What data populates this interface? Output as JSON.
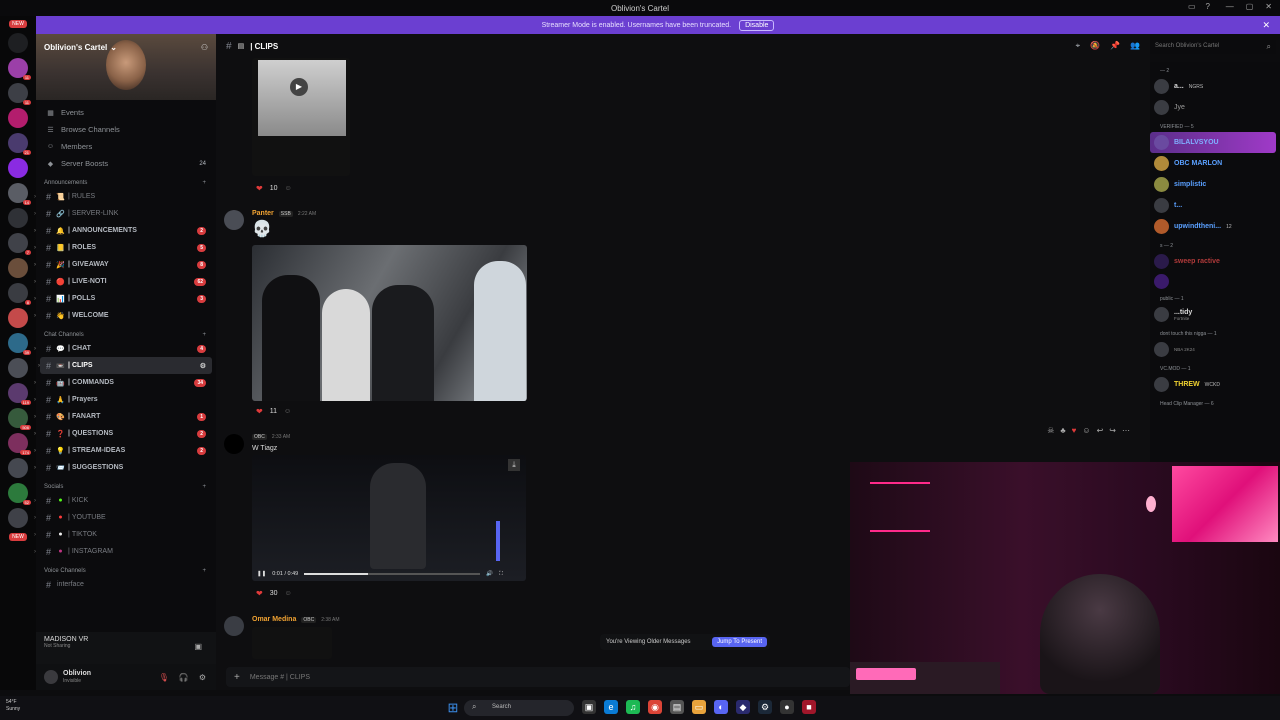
{
  "window": {
    "title": "Oblivion's Cartel"
  },
  "banner": {
    "text": "Streamer Mode is enabled. Usernames have been truncated.",
    "button": "Disable"
  },
  "rail": {
    "new_top": "NEW",
    "new_bottom": "NEW",
    "badges": [
      "11",
      "11",
      "21",
      "14",
      "7",
      "8",
      "39",
      "119",
      "506",
      "174",
      "52"
    ]
  },
  "server": {
    "name": "Oblivion's Cartel"
  },
  "sidebar": {
    "nav": [
      {
        "icon": "calendar-icon",
        "glyph": "▦",
        "label": "Events"
      },
      {
        "icon": "browse-channels-icon",
        "glyph": "☰",
        "label": "Browse Channels"
      },
      {
        "icon": "members-icon",
        "glyph": "☺",
        "label": "Members"
      },
      {
        "icon": "boost-icon",
        "glyph": "◆",
        "label": "Server Boosts",
        "extra": "24"
      }
    ],
    "categories": {
      "announcements": "Announcements",
      "chat": "Chat Channels",
      "socials": "Socials",
      "voice": "Voice Channels"
    },
    "announcements": [
      {
        "name": "RULES",
        "emoji": "📜",
        "badge": ""
      },
      {
        "name": "SERVER-LINK",
        "emoji": "🔗",
        "badge": ""
      },
      {
        "name": "ANNOUNCEMENTS",
        "emoji": "🔔",
        "badge": "2"
      },
      {
        "name": "ROLES",
        "emoji": "📒",
        "badge": "5"
      },
      {
        "name": "GIVEAWAY",
        "emoji": "🎉",
        "badge": "8"
      },
      {
        "name": "LIVE-NOTI",
        "emoji": "🔴",
        "badge": "62"
      },
      {
        "name": "POLLS",
        "emoji": "📊",
        "badge": "3"
      },
      {
        "name": "WELCOME",
        "emoji": "👋",
        "badge": ""
      }
    ],
    "chat": [
      {
        "name": "CHAT",
        "emoji": "💬",
        "badge": "4"
      },
      {
        "name": "CLIPS",
        "emoji": "📼",
        "badge": ""
      },
      {
        "name": "COMMANDS",
        "emoji": "🤖",
        "badge": "34"
      },
      {
        "name": "Prayers",
        "emoji": "🙏",
        "badge": ""
      },
      {
        "name": "FANART",
        "emoji": "🎨",
        "badge": "1"
      },
      {
        "name": "QUESTIONS",
        "emoji": "❓",
        "badge": "2"
      },
      {
        "name": "STREAM-IDEAS",
        "emoji": "💡",
        "badge": "2"
      },
      {
        "name": "SUGGESTIONS",
        "emoji": "📨",
        "badge": ""
      }
    ],
    "socials": [
      {
        "name": "KICK",
        "color": "#53fc18"
      },
      {
        "name": "YOUTUBE",
        "color": "#ff3b3b"
      },
      {
        "name": "TIKTOK",
        "color": "#eeeeee"
      },
      {
        "name": "INSTAGRAM",
        "color": "#c13584"
      }
    ],
    "voice": [
      {
        "name": "interface"
      }
    ]
  },
  "voice_status": {
    "title": "MADISON VR",
    "sub": "Not Sharing"
  },
  "user": {
    "name": "Oblivion",
    "status": "Invisible"
  },
  "channel": {
    "name": "| CLIPS"
  },
  "search": {
    "placeholder": "Search Oblivion's Cartel"
  },
  "messages": {
    "reaction1": "10",
    "msg2": {
      "author": "Panter",
      "tag": "SSB",
      "time": "2:22 AM",
      "emoji": "💀",
      "reaction": "11"
    },
    "msg3": {
      "tag": "OBC",
      "time": "2:33 AM",
      "text": "W Tiagz",
      "video_time": "0:01 / 0:49",
      "reaction": "30"
    },
    "msg4": {
      "author": "Omar Medina",
      "tag": "OBC",
      "time": "2:38 AM"
    }
  },
  "older": {
    "text": "You're Viewing Older Messages",
    "button": "Jump To Present"
  },
  "composer": {
    "placeholder": "Message # | CLIPS"
  },
  "members": {
    "cat1": "— 2",
    "m1": {
      "name": "a...",
      "tag": "NGRS"
    },
    "m2": {
      "name": "Jye"
    },
    "cat2": "VERIFIED — 5",
    "m3": {
      "name": "BILALVSYOU"
    },
    "m4": {
      "name": "OBC MARLON"
    },
    "m5": {
      "name": "simplistic"
    },
    "m6": {
      "name": "t..."
    },
    "m7": {
      "name": "upwindtheni...",
      "tag": "12"
    },
    "cat3": "s — 2",
    "m8": {
      "name": "sweep ractive"
    },
    "cat4": "public — 1",
    "m9": {
      "name": "...tidy",
      "sub": "Fortnite"
    },
    "cat5": "dont touch this nigga — 1",
    "m10": {
      "sub": "NBA 2K24"
    },
    "cat6": "VC.MOD — 1",
    "m11": {
      "name": "THREW",
      "tag": "WCKD"
    },
    "cat7": "Head Clip Manager — 6"
  },
  "taskbar": {
    "weather_temp": "54°F",
    "weather_desc": "Sunny",
    "search": "Search"
  },
  "colors": {
    "accent": "#5865f2",
    "banner": "#6b3fd1",
    "highlight": "#a03ac8",
    "member_blue": "#5aa0ff",
    "member_yellow": "#f0d230"
  }
}
